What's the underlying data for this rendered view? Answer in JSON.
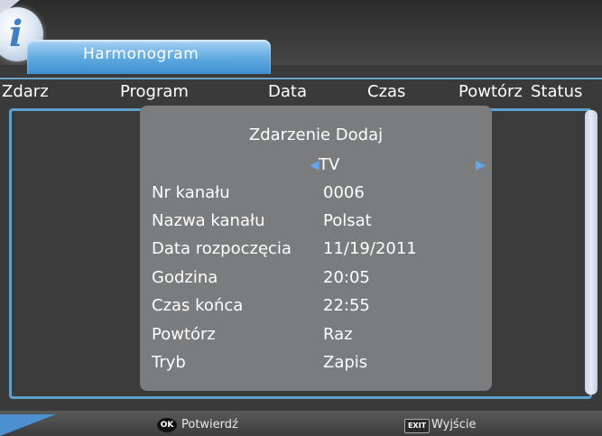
{
  "window": {
    "title": "Harmonogram",
    "logo_letter": "i"
  },
  "columns": [
    "Zdarz",
    "Program",
    "Data",
    "Czas",
    "Powtórz",
    "Status"
  ],
  "dialog": {
    "title": "Zdarzenie Dodaj",
    "type_value": "TV",
    "fields": [
      {
        "label": "Nr kanału",
        "value": "0006"
      },
      {
        "label": "Nazwa kanału",
        "value": "Polsat"
      },
      {
        "label": "Data rozpoczęcia",
        "value": "11/19/2011"
      },
      {
        "label": "Godzina",
        "value": "20:05"
      },
      {
        "label": "Czas końca",
        "value": "22:55"
      },
      {
        "label": "Powtórz",
        "value": "Raz"
      },
      {
        "label": "Tryb",
        "value": "Zapis"
      }
    ]
  },
  "footer": {
    "ok_key": "OK",
    "confirm_label": "Potwierdź",
    "exit_key": "EXIT",
    "exit_label": "Wyjście"
  },
  "icons": {
    "logo": "info-icon",
    "left_arrow": "arrow-left-icon",
    "right_arrow": "arrow-right-icon"
  },
  "colors": {
    "accent": "#5fa8e0",
    "dialog_bg": "#7b7c7d",
    "background": "#3a3a3a"
  }
}
